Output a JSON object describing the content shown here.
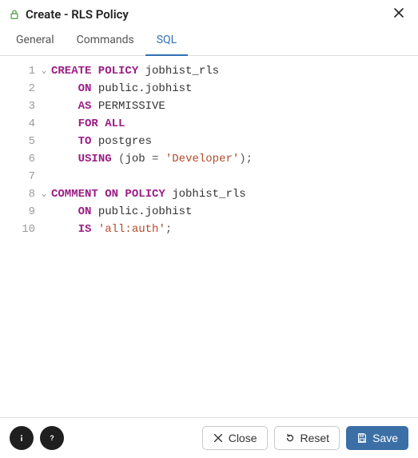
{
  "header": {
    "title": "Create - RLS Policy",
    "icon": "lock-icon"
  },
  "tabs": [
    {
      "label": "General",
      "active": false
    },
    {
      "label": "Commands",
      "active": false
    },
    {
      "label": "SQL",
      "active": true
    }
  ],
  "editor": {
    "fold_lines": [
      1,
      8
    ],
    "lines": [
      {
        "n": 1,
        "tokens": [
          [
            "kw",
            "CREATE POLICY"
          ],
          [
            "ident",
            " jobhist_rls"
          ]
        ]
      },
      {
        "n": 2,
        "tokens": [
          [
            "plain",
            "    "
          ],
          [
            "kw",
            "ON"
          ],
          [
            "ident",
            " public.jobhist"
          ]
        ]
      },
      {
        "n": 3,
        "tokens": [
          [
            "plain",
            "    "
          ],
          [
            "kw",
            "AS"
          ],
          [
            "ident",
            " PERMISSIVE"
          ]
        ]
      },
      {
        "n": 4,
        "tokens": [
          [
            "plain",
            "    "
          ],
          [
            "kw",
            "FOR ALL"
          ]
        ]
      },
      {
        "n": 5,
        "tokens": [
          [
            "plain",
            "    "
          ],
          [
            "kw",
            "TO"
          ],
          [
            "ident",
            " postgres"
          ]
        ]
      },
      {
        "n": 6,
        "tokens": [
          [
            "plain",
            "    "
          ],
          [
            "kw",
            "USING"
          ],
          [
            "punct",
            " ("
          ],
          [
            "ident",
            "job "
          ],
          [
            "punct",
            "= "
          ],
          [
            "str",
            "'Developer'"
          ],
          [
            "punct",
            ");"
          ]
        ]
      },
      {
        "n": 7,
        "tokens": []
      },
      {
        "n": 8,
        "tokens": [
          [
            "kw",
            "COMMENT ON POLICY"
          ],
          [
            "ident",
            " jobhist_rls"
          ]
        ]
      },
      {
        "n": 9,
        "tokens": [
          [
            "plain",
            "    "
          ],
          [
            "kw",
            "ON"
          ],
          [
            "ident",
            " public.jobhist"
          ]
        ]
      },
      {
        "n": 10,
        "tokens": [
          [
            "plain",
            "    "
          ],
          [
            "kw",
            "IS"
          ],
          [
            "plain",
            " "
          ],
          [
            "str",
            "'all:auth'"
          ],
          [
            "punct",
            ";"
          ]
        ]
      }
    ]
  },
  "footer": {
    "info_icon": "info-icon",
    "help_icon": "help-icon",
    "close_label": "Close",
    "reset_label": "Reset",
    "save_label": "Save"
  },
  "colors": {
    "keyword": "#9a1d84",
    "string": "#b34a2a",
    "tab_active": "#2f6fb5",
    "primary_button": "#3b6fa6"
  }
}
